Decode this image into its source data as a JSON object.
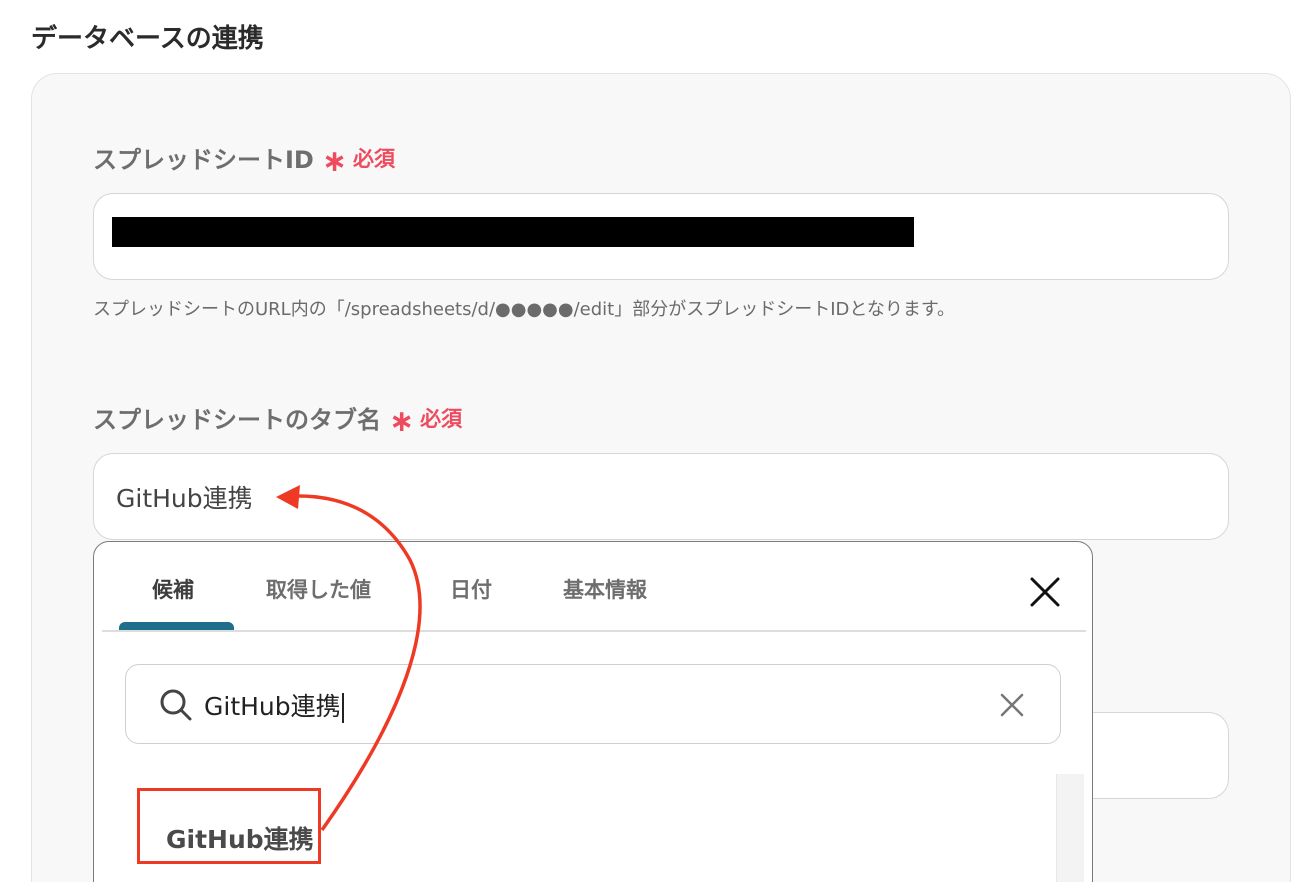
{
  "section": {
    "title": "データベースの連携"
  },
  "spreadsheet_id": {
    "label": "スプレッドシートID",
    "required_mark": "∗",
    "required_text": "必須",
    "hint": "スプレッドシートのURL内の「/spreadsheets/d/●●●●●/edit」部分がスプレッドシートIDとなります。"
  },
  "tab_name": {
    "label": "スプレッドシートのタブ名",
    "required_mark": "∗",
    "required_text": "必須",
    "value": "GitHub連携"
  },
  "popup": {
    "tabs": [
      {
        "label": "候補",
        "active": true
      },
      {
        "label": "取得した値",
        "active": false
      },
      {
        "label": "日付",
        "active": false
      },
      {
        "label": "基本情報",
        "active": false
      }
    ],
    "search": {
      "value": "GitHub連携"
    },
    "suggestions": [
      {
        "label": "GitHub連携"
      }
    ]
  },
  "colors": {
    "required": "#ef4b5f",
    "tab_underline": "#1f6e8a",
    "annotation": "#ee3a24"
  }
}
